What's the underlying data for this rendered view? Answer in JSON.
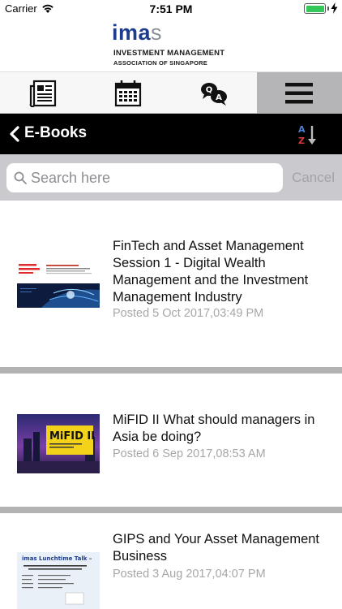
{
  "status_bar": {
    "carrier": "Carrier",
    "time": "7:51 PM",
    "battery_level": 1.0,
    "battery_color": "#34c759"
  },
  "brand": {
    "logo_prefix": "ima",
    "logo_suffix": "s",
    "name": "INVESTMENT MANAGEMENT",
    "subtitle": "ASSOCIATION OF SINGAPORE",
    "logo_color": "#1d3d8c"
  },
  "tabs": [
    {
      "icon": "newspaper-icon",
      "active": false
    },
    {
      "icon": "calendar-icon",
      "active": false
    },
    {
      "icon": "qa-chat-icon",
      "active": false
    },
    {
      "icon": "hamburger-menu-icon",
      "active": true
    }
  ],
  "navbar": {
    "title": "E-Books",
    "back_icon": "chevron-left-icon",
    "sort_icon": "sort-a-z-icon"
  },
  "search": {
    "placeholder": "Search here",
    "value": "",
    "cancel_label": "Cancel"
  },
  "items": [
    {
      "title": "FinTech and Asset Management Session 1 - Digital Wealth Management and the Investment Management Industry",
      "date": "Posted 5 Oct 2017,03:49 PM",
      "thumb": {
        "brand": "Asset Management Dialog",
        "heading": "Digital Wealth Management and the Investment Management Industry"
      }
    },
    {
      "title": "MiFID II What should managers in Asia be doing?",
      "date": "Posted 6 Sep 2017,08:53 AM",
      "thumb": {
        "heading": "MiFID II",
        "sub": "What should managers in Asia be doing?"
      }
    },
    {
      "title": "GIPS and Your Asset Management Business",
      "date": "Posted 3 Aug 2017,04:07 PM",
      "thumb": {
        "heading": "imas Lunchtime Talk –",
        "sub": "GIPS and Your Asset Management Business"
      }
    }
  ]
}
